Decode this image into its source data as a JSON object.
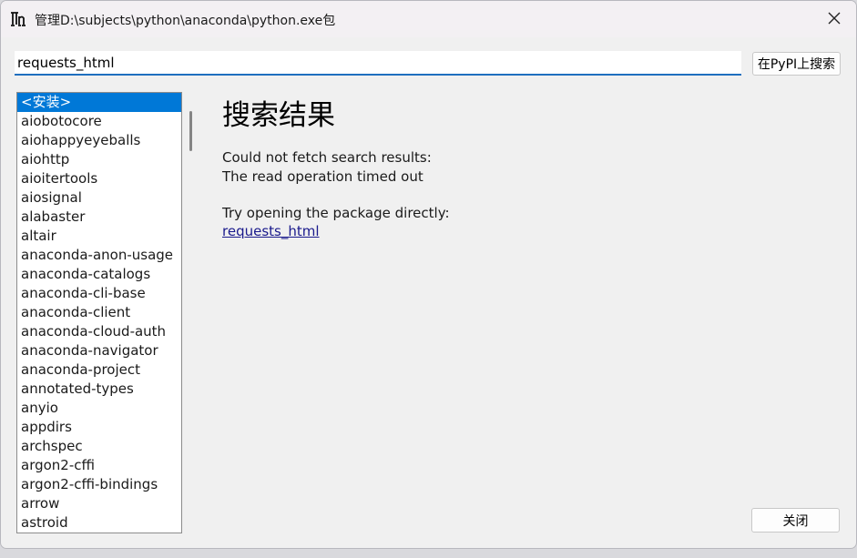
{
  "window": {
    "title": "管理D:\\subjects\\python\\anaconda\\python.exe包",
    "app_icon": "thonny-logo-icon",
    "close_icon": "close-icon"
  },
  "search": {
    "value": "requests_html",
    "button_label": "在PyPI上搜索"
  },
  "package_list": {
    "selected_index": 0,
    "items": [
      "<安装>",
      "aiobotocore",
      "aiohappyeyeballs",
      "aiohttp",
      "aioitertools",
      "aiosignal",
      "alabaster",
      "altair",
      "anaconda-anon-usage",
      "anaconda-catalogs",
      "anaconda-cli-base",
      "anaconda-client",
      "anaconda-cloud-auth",
      "anaconda-navigator",
      "anaconda-project",
      "annotated-types",
      "anyio",
      "appdirs",
      "archspec",
      "argon2-cffi",
      "argon2-cffi-bindings",
      "arrow",
      "astroid"
    ]
  },
  "results": {
    "heading": "搜索结果",
    "error_line1": "Could not fetch search results:",
    "error_line2": "The read operation timed out",
    "hint": "Try opening the package directly:",
    "link": "requests_html"
  },
  "footer": {
    "close_label": "关闭"
  },
  "colors": {
    "accent": "#0078d7",
    "input_underline": "#1e6fbf",
    "link": "#1a1a8c",
    "background": "#f0f0f0"
  }
}
